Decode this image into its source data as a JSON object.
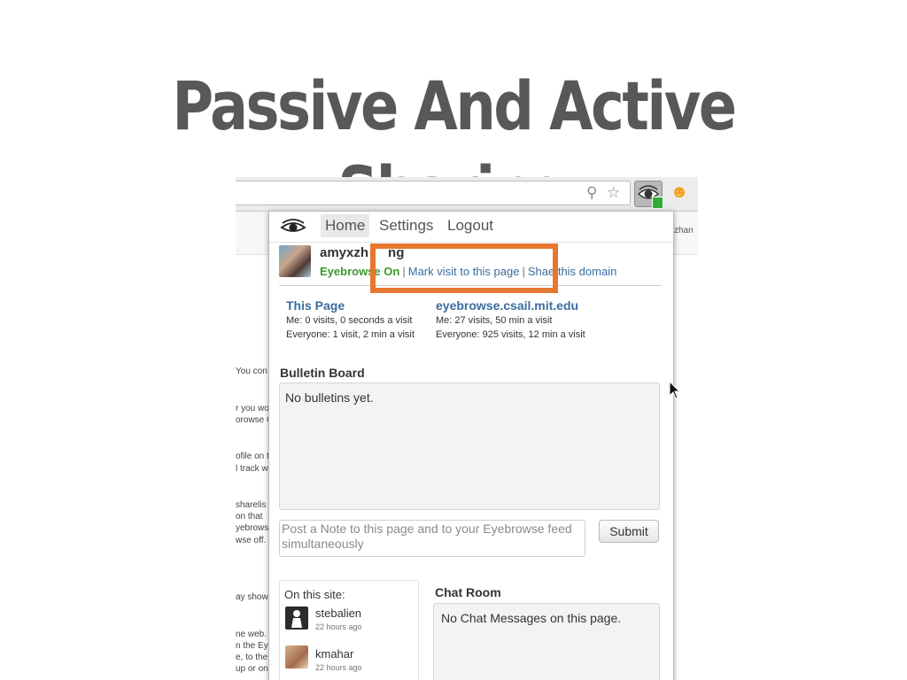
{
  "slide_title": "Passive And Active Sharing",
  "toolbar": {
    "zoom_icon": "magnifier-icon",
    "bookmark_icon": "star-icon",
    "extension_icon": "eye-icon",
    "cat_extension_icon": "cat-icon"
  },
  "background_page": {
    "user_fragment": "xzhan",
    "text_fragments": [
      "You con",
      "r you wo",
      "orowse C",
      "ofile on t",
      "l track w",
      "sharelis",
      "on that",
      "yebrows",
      "wse off.",
      "ay showi",
      "ne web. Y",
      "n the Ey",
      "e, to the",
      "up or on"
    ]
  },
  "popup": {
    "nav": {
      "home": "Home",
      "settings": "Settings",
      "logout": "Logout"
    },
    "user": {
      "name": "amyxzh",
      "name_tail": "ng",
      "status_label": "Eyebrows",
      "status_hidden": "e",
      "status_value": "On",
      "mark_visit": "Mark visit to this page",
      "share_domain_start": "Sha",
      "share_domain_end": "e this domain"
    },
    "this_page": {
      "title": "This Page",
      "me": "Me: 0 visits, 0 seconds a visit",
      "everyone": "Everyone: 1 visit, 2 min a visit"
    },
    "domain": {
      "title": "eyebrowse.csail.mit.edu",
      "me": "Me: 27 visits, 50 min a visit",
      "everyone": "Everyone: 925 visits, 12 min a visit"
    },
    "bulletin": {
      "title": "Bulletin Board",
      "empty": "No bulletins yet."
    },
    "note": {
      "placeholder": "Post a Note to this page and to your Eyebrowse feed simultaneously",
      "submit": "Submit"
    },
    "on_this_site": {
      "title": "On this site:",
      "users": [
        {
          "name": "stebalien",
          "time": "22 hours ago"
        },
        {
          "name": "kmahar",
          "time": "22 hours ago"
        }
      ]
    },
    "chat": {
      "title": "Chat Room",
      "empty": "No Chat Messages on this page."
    }
  },
  "colors": {
    "highlight": "#e7772f",
    "status_on": "#3a9a2a",
    "link": "#3a6d9e"
  }
}
